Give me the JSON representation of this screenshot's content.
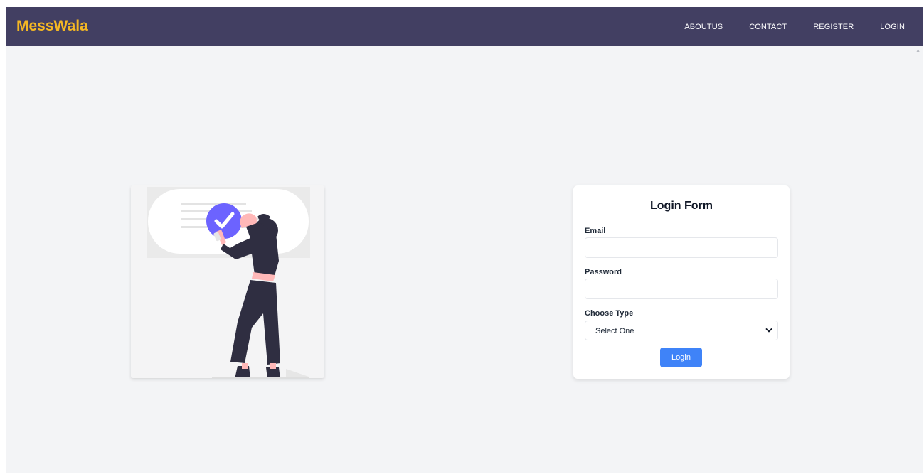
{
  "navbar": {
    "brand": "MessWala",
    "links": [
      "ABOUTUS",
      "CONTACT",
      "REGISTER",
      "LOGIN"
    ]
  },
  "colors": {
    "navbar_bg": "#423f62",
    "brand": "#f5b823",
    "page_bg": "#f3f4f6",
    "accent_circle": "#6c63ff",
    "button": "#3f83f8"
  },
  "illustration": {
    "icon": "checkmark-icon",
    "subject": "person-holding-phone"
  },
  "login_form": {
    "title": "Login Form",
    "email_label": "Email",
    "email_value": "",
    "password_label": "Password",
    "password_value": "",
    "type_label": "Choose Type",
    "type_selected": "Select One",
    "submit_label": "Login"
  }
}
